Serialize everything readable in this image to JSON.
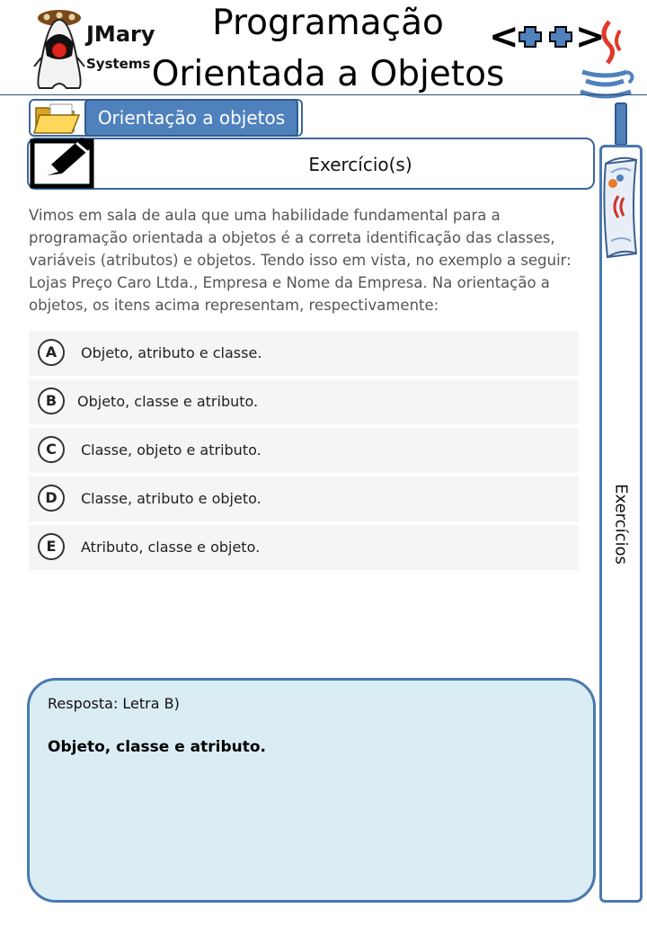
{
  "brand": {
    "line1": "JMary",
    "line2": "Systems"
  },
  "title": {
    "line1": "Programação",
    "line2": "Orientada a Objetos"
  },
  "section": {
    "label": "Orientação a objetos",
    "icon": "folder-icon"
  },
  "exercise_header": {
    "title": "Exercício(s)",
    "icon": "edit-icon"
  },
  "question": "Vimos em sala de aula que uma habilidade fundamental para a programação orientada a objetos é a correta identificação das classes, variáveis (atributos) e objetos. Tendo isso em vista, no exemplo a seguir: Lojas Preço Caro Ltda., Empresa e Nome da Empresa. Na orientação a objetos, os itens acima representam, respectivamente:",
  "options": [
    {
      "letter": "A",
      "text": "Objeto, atributo e classe."
    },
    {
      "letter": "B",
      "text": "Objeto, classe e atributo."
    },
    {
      "letter": "C",
      "text": "Classe, objeto e atributo."
    },
    {
      "letter": "D",
      "text": "Classe, atributo e objeto."
    },
    {
      "letter": "E",
      "text": "Atributo, classe e objeto."
    }
  ],
  "answer": {
    "label": "Resposta: Letra B)",
    "text": "Objeto, classe e atributo."
  },
  "side_tab": {
    "label": "Exercícios"
  },
  "cpp_badge": {
    "text": "<++>"
  },
  "colors": {
    "accent": "#4f81bd",
    "border": "#3b679a",
    "answer_bg": "#daedf4",
    "option_bg": "#f5f5f5"
  }
}
